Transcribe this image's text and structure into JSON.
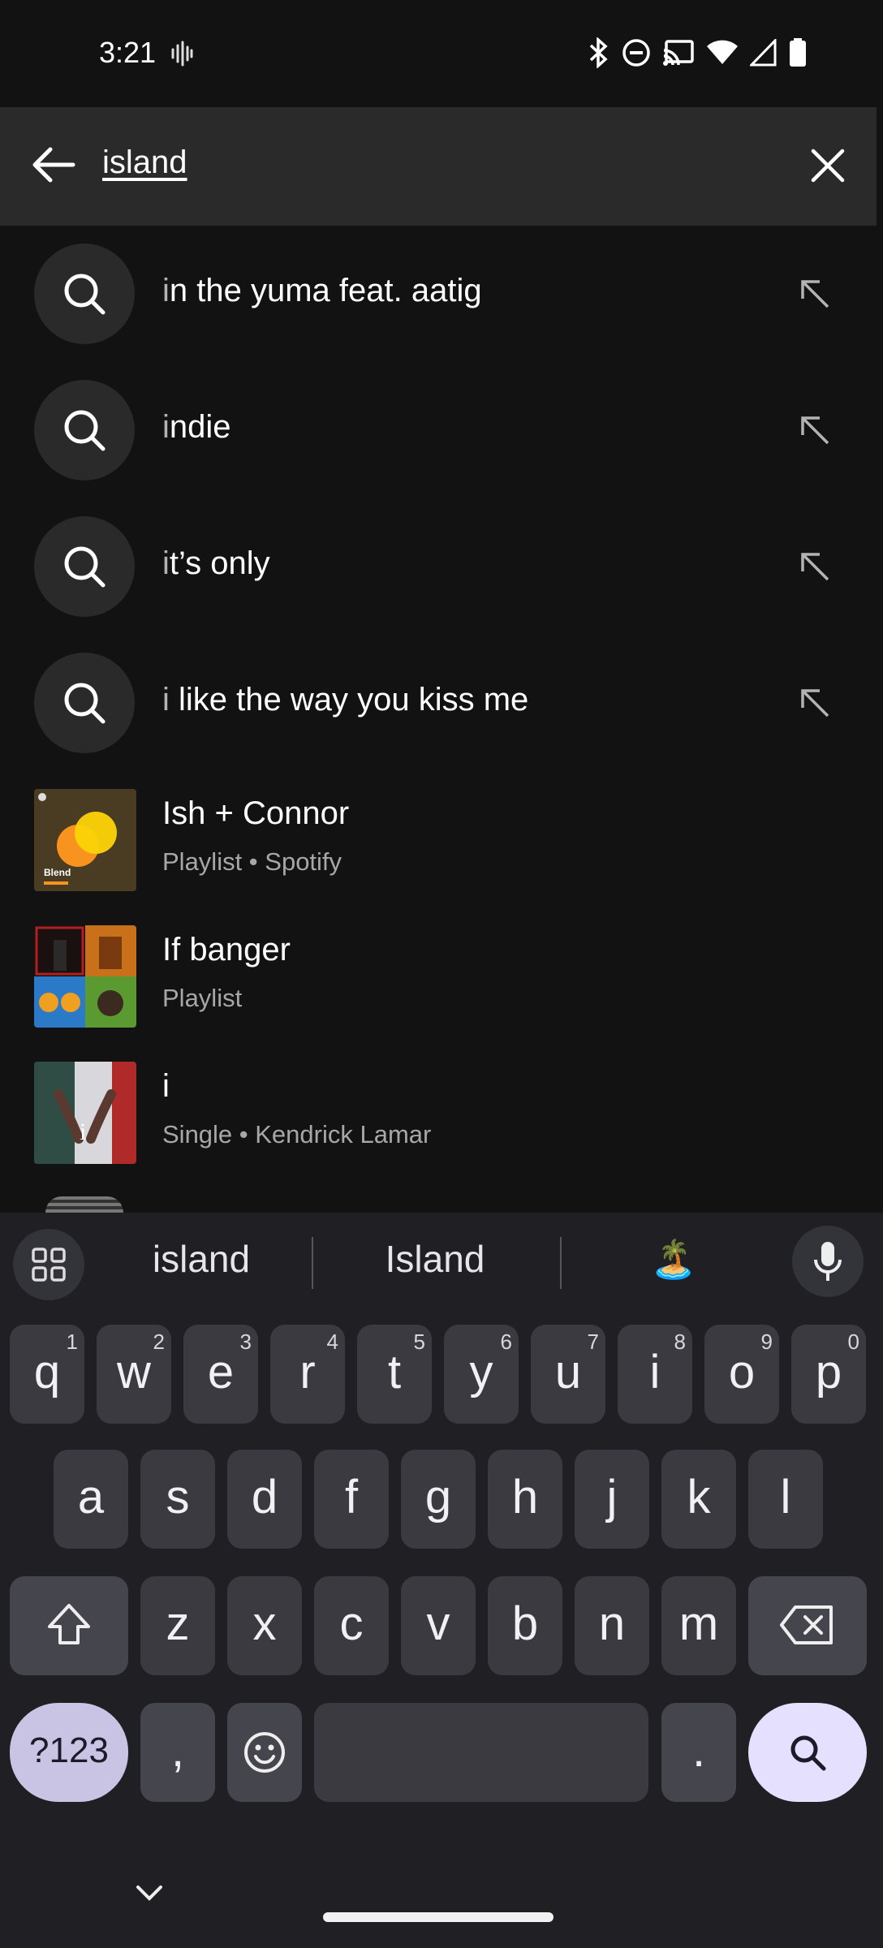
{
  "status_bar": {
    "time": "3:21"
  },
  "search": {
    "query": "island"
  },
  "suggestions": [
    {
      "typed": "i",
      "rest": "n the yuma feat. aatig"
    },
    {
      "typed": "i",
      "rest": "ndie"
    },
    {
      "typed": "i",
      "rest": "t’s only"
    },
    {
      "typed": "i",
      "rest": " like the way you kiss me"
    }
  ],
  "results": [
    {
      "title": "Ish + Connor",
      "subtitle": "Playlist • Spotify",
      "art_label": "Blend"
    },
    {
      "title": "If banger",
      "subtitle": "Playlist"
    },
    {
      "title": "i",
      "subtitle": "Single • Kendrick Lamar"
    }
  ],
  "keyboard": {
    "suggestions": [
      "island",
      "Island",
      "🏝️"
    ],
    "row1": [
      {
        "k": "q",
        "n": "1"
      },
      {
        "k": "w",
        "n": "2"
      },
      {
        "k": "e",
        "n": "3"
      },
      {
        "k": "r",
        "n": "4"
      },
      {
        "k": "t",
        "n": "5"
      },
      {
        "k": "y",
        "n": "6"
      },
      {
        "k": "u",
        "n": "7"
      },
      {
        "k": "i",
        "n": "8"
      },
      {
        "k": "o",
        "n": "9"
      },
      {
        "k": "p",
        "n": "0"
      }
    ],
    "row2": [
      "a",
      "s",
      "d",
      "f",
      "g",
      "h",
      "j",
      "k",
      "l"
    ],
    "row3": [
      "z",
      "x",
      "c",
      "v",
      "b",
      "n",
      "m"
    ],
    "symbols_label": "?123",
    "comma": ",",
    "period": "."
  },
  "colors": {
    "background": "#121212",
    "search_bar": "#2a2a2a",
    "keyboard": "#1f1f24",
    "search_key": "#e6e0ff"
  }
}
